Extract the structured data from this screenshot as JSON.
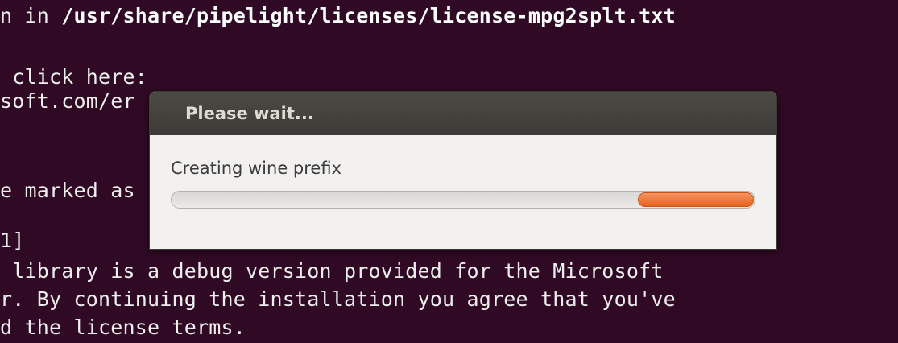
{
  "terminal": {
    "line1_prefix": "n in ",
    "line1_path": "/usr/share/pipelight/licenses/license-mpg2splt.txt",
    "line2": " click here:",
    "line3": "soft.com/er",
    "line4": "e marked as",
    "line5": "1]",
    "line6": " library is a debug version provided for the Microsoft",
    "line7": "r. By continuing the installation you agree that you've",
    "line8": "d the license terms."
  },
  "dialog": {
    "title": "Please wait...",
    "message": "Creating wine prefix",
    "progress_mode": "indeterminate-pulse",
    "pulse_color": "#ef7232"
  },
  "colors": {
    "terminal_bg": "#300a24",
    "terminal_fg": "#eeeeec",
    "titlebar_bg": "#3c3b37",
    "dialog_bg": "#f2f1f0"
  }
}
